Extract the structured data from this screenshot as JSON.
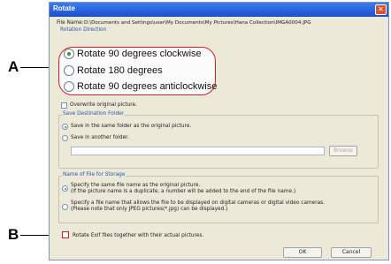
{
  "callouts": {
    "a": "A",
    "b": "B"
  },
  "dialog": {
    "title": "Rotate",
    "file_name_label": "File Name:",
    "file_name_value": "D:\\Documents and Settings\\user\\My Documents\\My Pictures\\Hana Collection\\IMGA0004.JPG",
    "rotation": {
      "title": "Rotation Direction",
      "options": [
        "Rotate 90 degrees clockwise",
        "Rotate 180 degrees",
        "Rotate 90 degrees anticlockwise"
      ],
      "selected": 0
    },
    "overwrite_label": "Overwrite original picture.",
    "save_dest": {
      "title": "Save Destination Folder",
      "same_label": "Save in the same folder as the original picture.",
      "another_label": "Save in another folder.",
      "folder_value": "",
      "browse_label": "Browse"
    },
    "storage": {
      "title": "Name of File for Storage",
      "opt1_line1": "Specify the same file name as the original picture.",
      "opt1_line2": "(If the picture name is a duplicate, a number will be added to the end of the file name.)",
      "opt2_line1": "Specify a file name that allows the file to be displayed on digital cameras or digital video cameras.",
      "opt2_line2": "(Please note that only JPEG pictures(*.jpg) can be displayed.)"
    },
    "rotate_exif_label": "Rotate Exif files together with their actual pictures.",
    "ok_label": "OK",
    "cancel_label": "Cancel"
  },
  "colors": {
    "highlight": "#d9201f",
    "titlebar": "#2358d8",
    "group_title": "#2b55a8"
  }
}
